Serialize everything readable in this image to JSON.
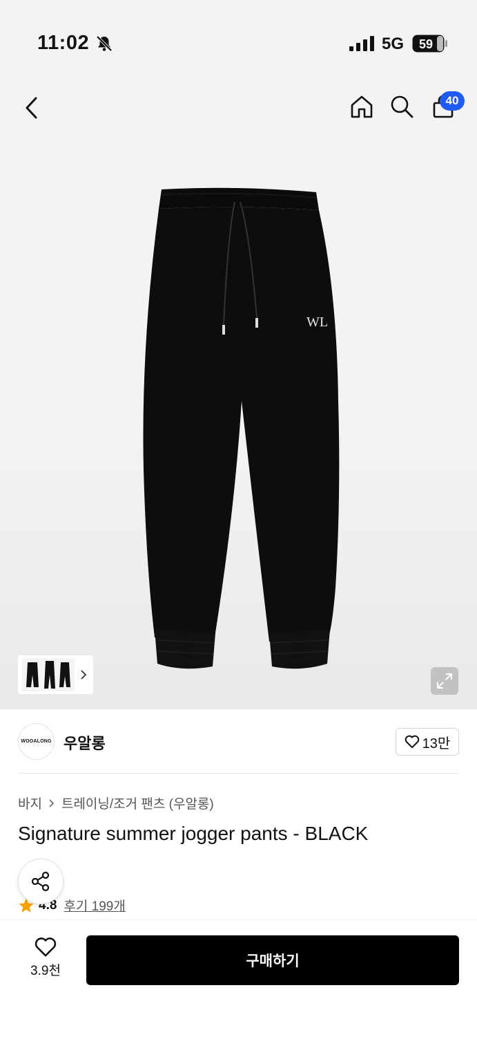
{
  "status_bar": {
    "time": "11:02",
    "network": "5G",
    "battery": "59"
  },
  "header": {
    "cart_count": "40"
  },
  "brand": {
    "logo_text": "WOOALONG",
    "name": "우알롱",
    "likes": "13만"
  },
  "breadcrumb": {
    "category": "바지",
    "subcategory": "트레이닝/조거 팬츠 (우알롱)"
  },
  "product": {
    "title": "Signature summer jogger pants - BLACK"
  },
  "rating": {
    "value": "4.8",
    "reviews": "후기 199개"
  },
  "bottom": {
    "wish_count": "3.9천",
    "buy_label": "구매하기"
  },
  "colors": {
    "accent_badge": "#1f5cf5",
    "star": "#f5a300",
    "buy": "#000000"
  }
}
